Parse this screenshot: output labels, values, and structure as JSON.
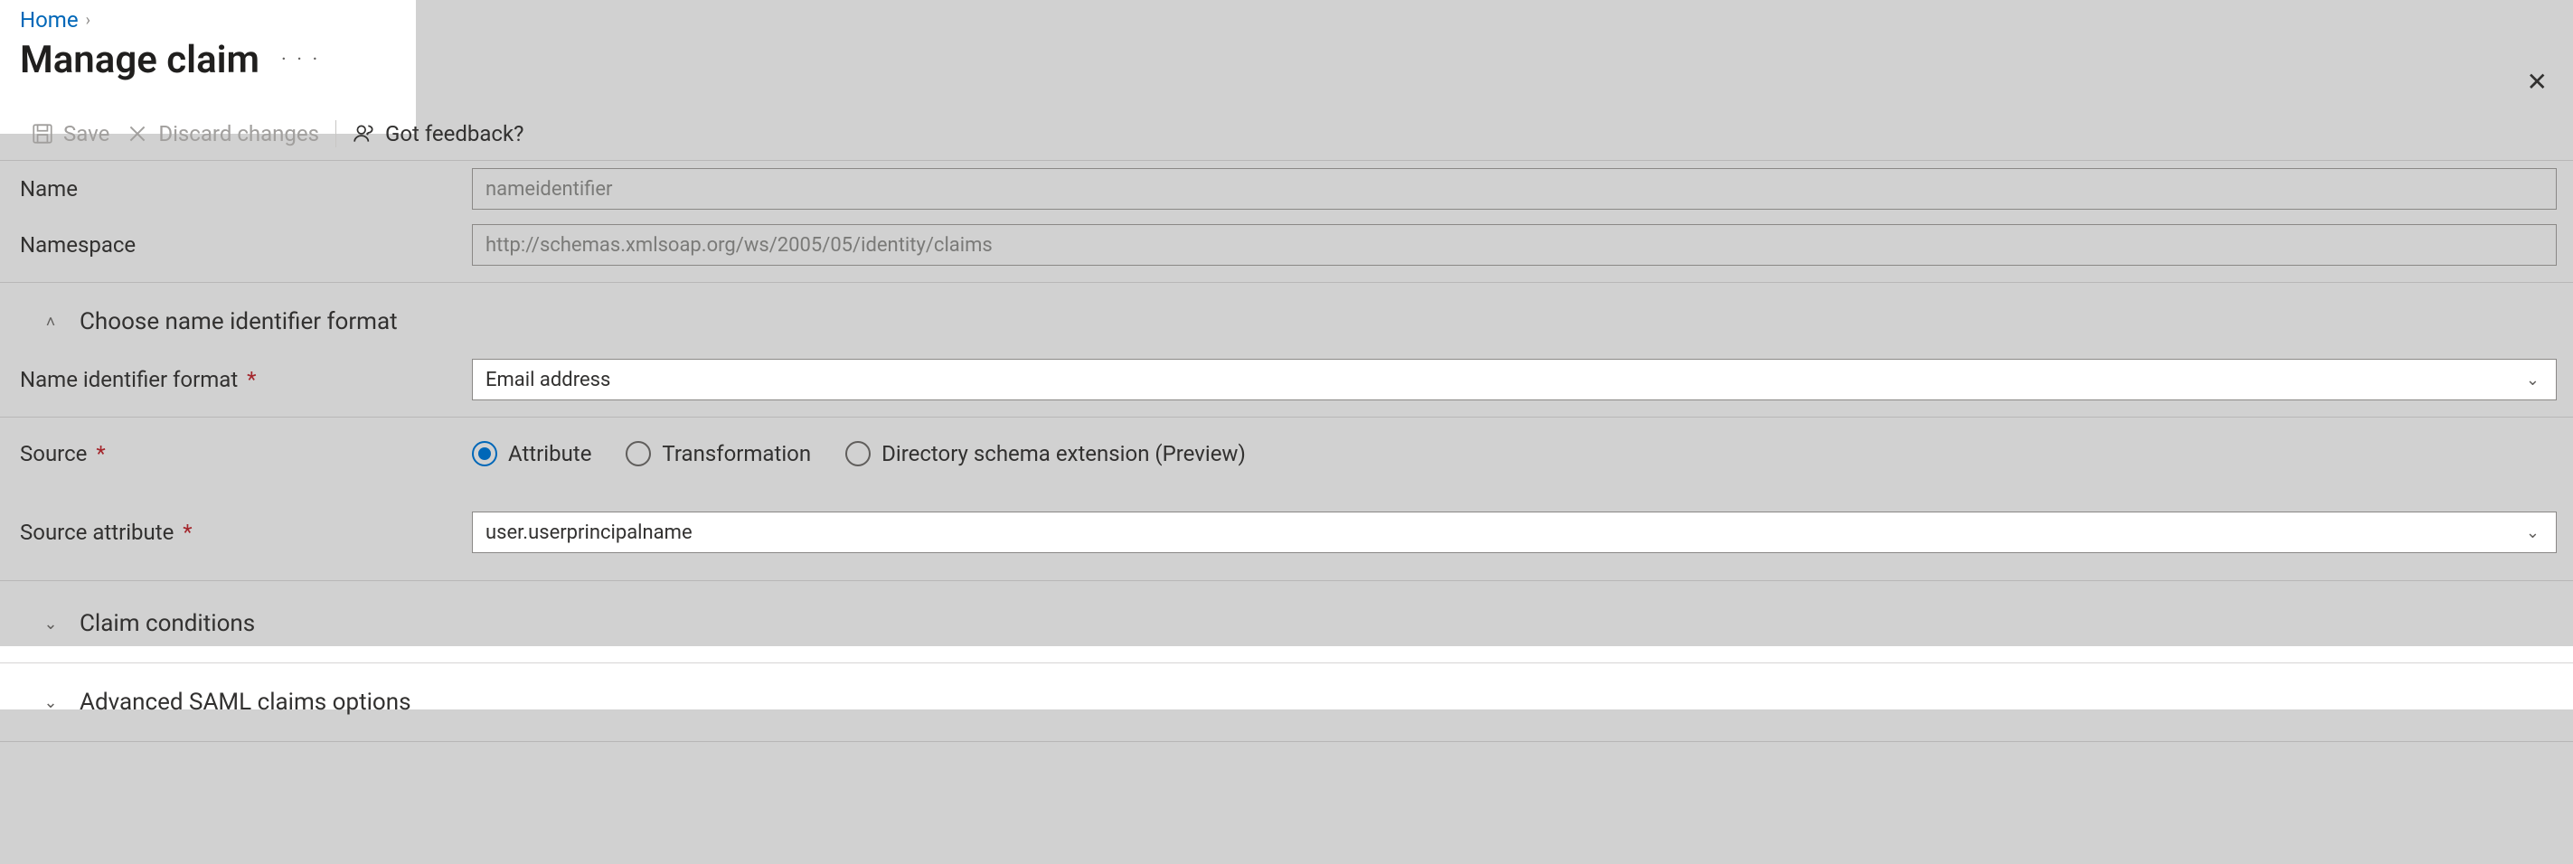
{
  "breadcrumb": {
    "home": "Home"
  },
  "page_title": "Manage claim",
  "toolbar": {
    "save": "Save",
    "discard": "Discard changes",
    "feedback": "Got feedback?"
  },
  "fields": {
    "name_label": "Name",
    "name_value": "nameidentifier",
    "namespace_label": "Namespace",
    "namespace_value": "http://schemas.xmlsoap.org/ws/2005/05/identity/claims",
    "choose_nif_header": "Choose name identifier format",
    "nif_label": "Name identifier format",
    "nif_value": "Email address",
    "source_label": "Source",
    "source_options": {
      "attribute": "Attribute",
      "transformation": "Transformation",
      "dir_ext": "Directory schema extension (Preview)"
    },
    "source_attr_label": "Source attribute",
    "source_attr_value": "user.userprincipalname",
    "claim_conditions_header": "Claim conditions",
    "advanced_header": "Advanced SAML claims options"
  },
  "icons": {
    "chevron_right": "›",
    "chevron_down": "⌄",
    "chevron_up": "˄",
    "close": "✕",
    "more": "· · ·"
  }
}
